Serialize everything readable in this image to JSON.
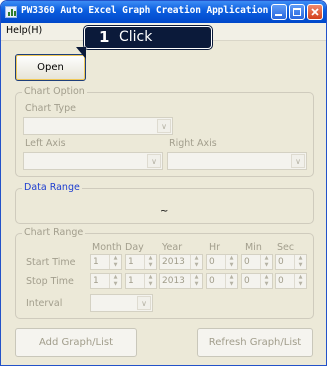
{
  "window": {
    "title": "PW3360 Auto Excel Graph Creation Application"
  },
  "menu": {
    "help": "Help(H)"
  },
  "annotation": {
    "step_number": "1",
    "step_text": "Click"
  },
  "buttons": {
    "open": "Open",
    "add_graph_list": "Add Graph/List",
    "refresh_graph_list": "Refresh Graph/List"
  },
  "chart_option": {
    "group_label": "Chart Option",
    "chart_type_label": "Chart Type",
    "chart_type_value": "",
    "left_axis_label": "Left Axis",
    "left_axis_value": "",
    "right_axis_label": "Right Axis",
    "right_axis_value": ""
  },
  "data_range": {
    "group_label": "Data Range",
    "separator": "~"
  },
  "chart_range": {
    "group_label": "Chart Range",
    "columns": [
      "Month",
      "Day",
      "Year",
      "Hr",
      "Min",
      "Sec"
    ],
    "start_label": "Start Time",
    "stop_label": "Stop Time",
    "start_values": [
      "1",
      "1",
      "2013",
      "0",
      "0",
      "0"
    ],
    "stop_values": [
      "1",
      "1",
      "2013",
      "0",
      "0",
      "0"
    ],
    "interval_label": "Interval",
    "interval_value": ""
  },
  "colors": {
    "titlebar": "#0a5ddf",
    "window_bg": "#ece9d8",
    "callout_bg": "#0b1a3a",
    "group_title_active": "#1e3ed0"
  }
}
